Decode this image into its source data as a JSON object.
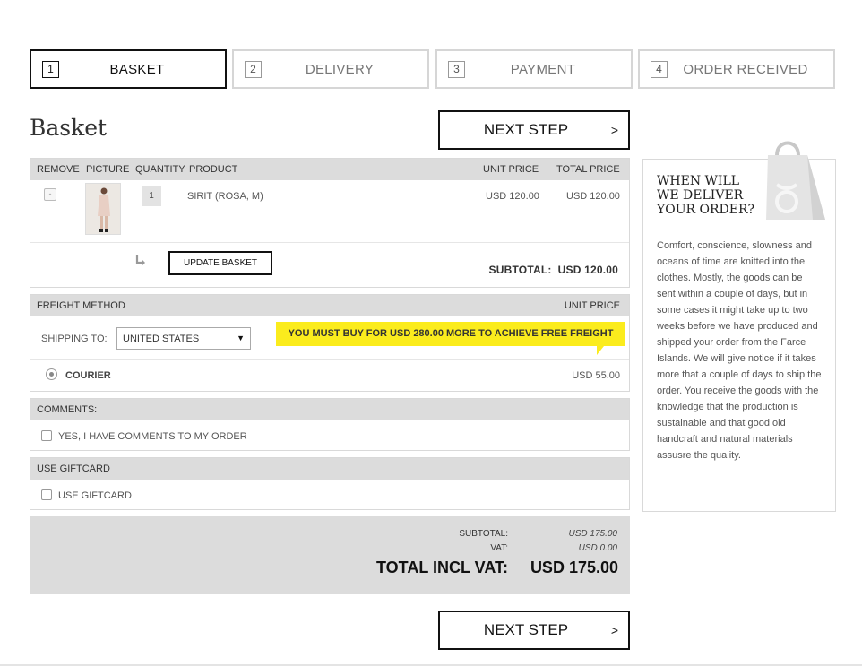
{
  "steps": [
    {
      "num": "1",
      "label": "BASKET"
    },
    {
      "num": "2",
      "label": "DELIVERY"
    },
    {
      "num": "3",
      "label": "PAYMENT"
    },
    {
      "num": "4",
      "label": "ORDER RECEIVED"
    }
  ],
  "page_title": "Basket",
  "next_step": {
    "label": "NEXT STEP",
    "arrow": ">"
  },
  "basket": {
    "headers": {
      "remove": "REMOVE",
      "picture": "PICTURE",
      "quantity": "QUANTITY",
      "product": "PRODUCT",
      "unit_price": "UNIT PRICE",
      "total_price": "TOTAL PRICE"
    },
    "items": [
      {
        "remove": "-",
        "quantity": "1",
        "product": "SIRIT (ROSA, M)",
        "unit_price": "USD 120.00",
        "total_price": "USD 120.00"
      }
    ],
    "update_label": "UPDATE BASKET",
    "subtotal_label": "SUBTOTAL:",
    "subtotal_value": "USD 120.00"
  },
  "freight": {
    "header": "FREIGHT METHOD",
    "header_price": "UNIT PRICE",
    "shipping_label": "SHIPPING TO:",
    "country": "UNITED STATES",
    "free_freight_notice": "YOU MUST BUY FOR USD 280.00 MORE TO ACHIEVE FREE FREIGHT",
    "method": "COURIER",
    "price": "USD 55.00"
  },
  "comments": {
    "header": "COMMENTS:",
    "checkbox_label": "YES, I HAVE COMMENTS TO MY ORDER"
  },
  "giftcard": {
    "header": "USE GIFTCARD",
    "checkbox_label": "USE GIFTCARD"
  },
  "totals": {
    "subtotal_label": "SUBTOTAL:",
    "subtotal_value": "USD 175.00",
    "vat_label": "VAT:",
    "vat_value": "USD 0.00",
    "total_label": "TOTAL INCL VAT:",
    "total_value": "USD 175.00"
  },
  "delivery_info": {
    "title": "WHEN WILL WE DELIVER YOUR ORDER?",
    "text": "Comfort, conscience, slowness and oceans of time are knitted into the clothes. Mostly, the goods can be sent within a couple of days, but in some cases it might take up to two weeks before we have produced and shipped your order from the Farce Islands. We will give notice if it takes more that a couple of days to ship the order. You receive the goods with the knowledge that the production is sustainable and that good old handcraft and natural materials assusre the quality."
  },
  "colors": {
    "notice_yellow": "#fbec1d",
    "header_gray": "#dcdcdc",
    "active_border": "#111111"
  },
  "icons": [
    "shopping-bag-icon",
    "return-arrow-icon",
    "caret-down-icon"
  ]
}
